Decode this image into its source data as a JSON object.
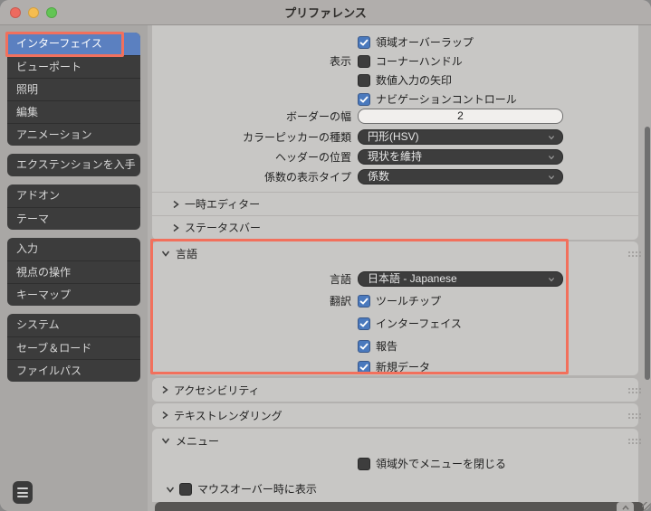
{
  "colors": {
    "accent_blue": "#4a79bd",
    "selected_blue": "#5b80c0",
    "annotation_red": "#f2705c",
    "traffic_red": "#ed6a5f",
    "traffic_yellow": "#f6bd50",
    "traffic_green": "#62c554"
  },
  "titlebar": {
    "title": "プリファレンス"
  },
  "sidebar": {
    "groups": [
      {
        "items": [
          {
            "label": "インターフェイス",
            "selected": true
          },
          {
            "label": "ビューポート",
            "selected": false
          },
          {
            "label": "照明",
            "selected": false
          },
          {
            "label": "編集",
            "selected": false
          },
          {
            "label": "アニメーション",
            "selected": false
          }
        ]
      },
      {
        "items": [
          {
            "label": "エクステンションを入手",
            "selected": false
          }
        ]
      },
      {
        "items": [
          {
            "label": "アドオン",
            "selected": false
          },
          {
            "label": "テーマ",
            "selected": false
          }
        ]
      },
      {
        "items": [
          {
            "label": "入力",
            "selected": false
          },
          {
            "label": "視点の操作",
            "selected": false
          },
          {
            "label": "キーマップ",
            "selected": false
          }
        ]
      },
      {
        "items": [
          {
            "label": "システム",
            "selected": false
          },
          {
            "label": "セーブ＆ロード",
            "selected": false
          },
          {
            "label": "ファイルパス",
            "selected": false
          }
        ]
      }
    ]
  },
  "content": {
    "iface": {
      "checks": [
        {
          "prefix": "",
          "label": "領域オーバーラップ",
          "checked": true
        },
        {
          "prefix": "表示",
          "label": "コーナーハンドル",
          "checked": false
        },
        {
          "prefix": "",
          "label": "数値入力の矢印",
          "checked": false
        },
        {
          "prefix": "",
          "label": "ナビゲーションコントロール",
          "checked": true
        }
      ],
      "number_field": {
        "label": "ボーダーの幅",
        "value": "2"
      },
      "selects": [
        {
          "label": "カラーピッカーの種類",
          "value": "円形(HSV)"
        },
        {
          "label": "ヘッダーの位置",
          "value": "現状を維持"
        },
        {
          "label": "係数の表示タイプ",
          "value": "係数"
        }
      ],
      "subpanels": [
        {
          "label": "一時エディター"
        },
        {
          "label": "ステータスバー"
        }
      ]
    },
    "language": {
      "title": "言語",
      "language_label": "言語",
      "language_value": "日本語 - Japanese",
      "checks": [
        {
          "prefix": "翻訳",
          "label": "ツールチップ",
          "checked": true
        },
        {
          "prefix": "",
          "label": "インターフェイス",
          "checked": true
        },
        {
          "prefix": "",
          "label": "報告",
          "checked": true
        },
        {
          "prefix": "",
          "label": "新規データ",
          "checked": true
        }
      ]
    },
    "collapsed_panels": [
      {
        "title": "アクセシビリティ"
      },
      {
        "title": "テキストレンダリング"
      }
    ],
    "menu": {
      "title": "メニュー",
      "close_check": {
        "label": "領域外でメニューを閉じる",
        "checked": false
      },
      "mouseover_check": {
        "label": "マウスオーバー時に表示",
        "checked": false
      }
    }
  }
}
